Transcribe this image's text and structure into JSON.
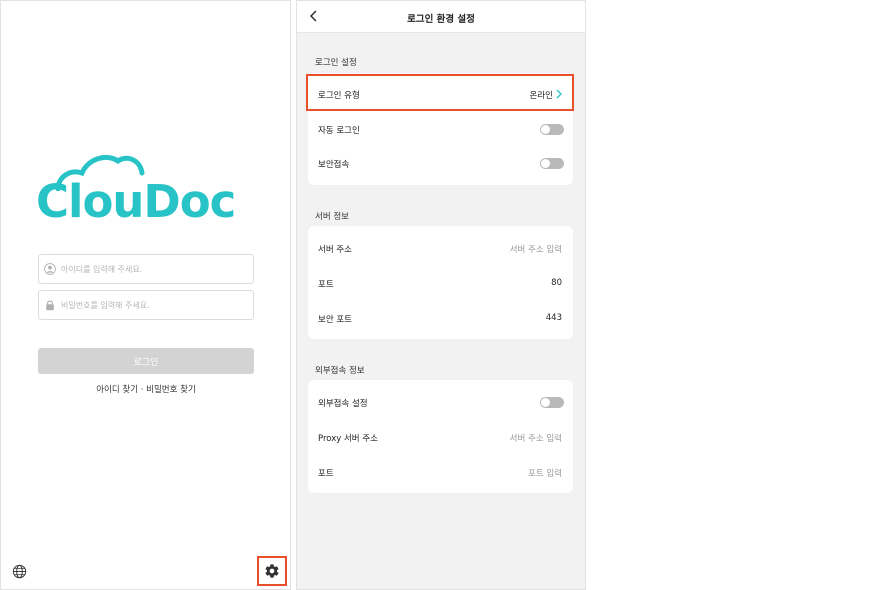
{
  "login": {
    "logo_text": "ClouDoc",
    "id_placeholder": "아이디를 입력해 주세요.",
    "pw_placeholder": "비밀번호를 입력해 주세요.",
    "login_button": "로그인",
    "find_link": "아이디 찾기 · 비밀번호 찾기",
    "brand_color": "#27c3c6",
    "icons": {
      "user": "user-icon",
      "lock": "lock-icon",
      "globe": "globe-icon",
      "settings": "gear-icon"
    }
  },
  "settings": {
    "title": "로그인 환경 설정",
    "sections": {
      "login": {
        "title": "로그인 설정",
        "login_type_label": "로그인 유형",
        "login_type_value": "온라인",
        "auto_login_label": "자동 로그인",
        "auto_login_on": false,
        "secure_label": "보안접속",
        "secure_on": false
      },
      "server": {
        "title": "서버 정보",
        "address_label": "서버 주소",
        "address_placeholder": "서버 주소 입력",
        "port_label": "포트",
        "port_value": "80",
        "secure_port_label": "보안 포트",
        "secure_port_value": "443"
      },
      "external": {
        "title": "외부접속 정보",
        "external_label": "외부접속 설정",
        "external_on": false,
        "proxy_label": "Proxy 서버 주소",
        "proxy_placeholder": "서버 주소 입력",
        "port_label": "포트",
        "port_placeholder": "포트 입력"
      }
    },
    "highlight_color": "#e8502b"
  }
}
